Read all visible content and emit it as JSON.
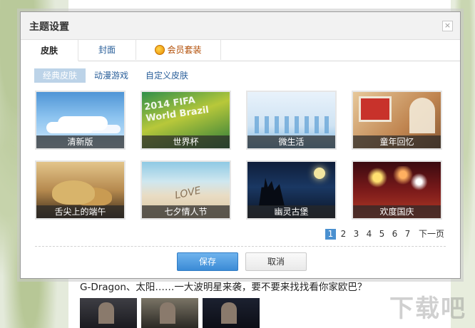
{
  "background": {
    "headline": "G-Dragon、太阳……一大波明星来袭，要不要来找找看你家欧巴？",
    "watermark": "下载吧"
  },
  "dialog": {
    "title": "主题设置",
    "close_symbol": "×",
    "tabs": [
      {
        "label": "皮肤",
        "active": true
      },
      {
        "label": "封面",
        "active": false
      },
      {
        "label": "会员套装",
        "active": false,
        "icon": "vip-icon"
      }
    ],
    "subtabs": [
      {
        "label": "经典皮肤",
        "active": true
      },
      {
        "label": "动漫游戏",
        "active": false
      },
      {
        "label": "自定义皮肤",
        "active": false
      }
    ],
    "skins": [
      {
        "label": "清新版"
      },
      {
        "label": "世界杯"
      },
      {
        "label": "微生活"
      },
      {
        "label": "童年回忆"
      },
      {
        "label": "舌尖上的端午"
      },
      {
        "label": "七夕情人节"
      },
      {
        "label": "幽灵古堡"
      },
      {
        "label": "欢度国庆"
      }
    ],
    "pagination": {
      "pages": [
        "1",
        "2",
        "3",
        "4",
        "5",
        "6",
        "7"
      ],
      "current": "1",
      "next_label": "下一页"
    },
    "buttons": {
      "save": "保存",
      "cancel": "取消"
    }
  },
  "colors": {
    "accent": "#3b8bd6",
    "link": "#2a5f9a",
    "subtab_active_bg": "#bcd3e8"
  }
}
